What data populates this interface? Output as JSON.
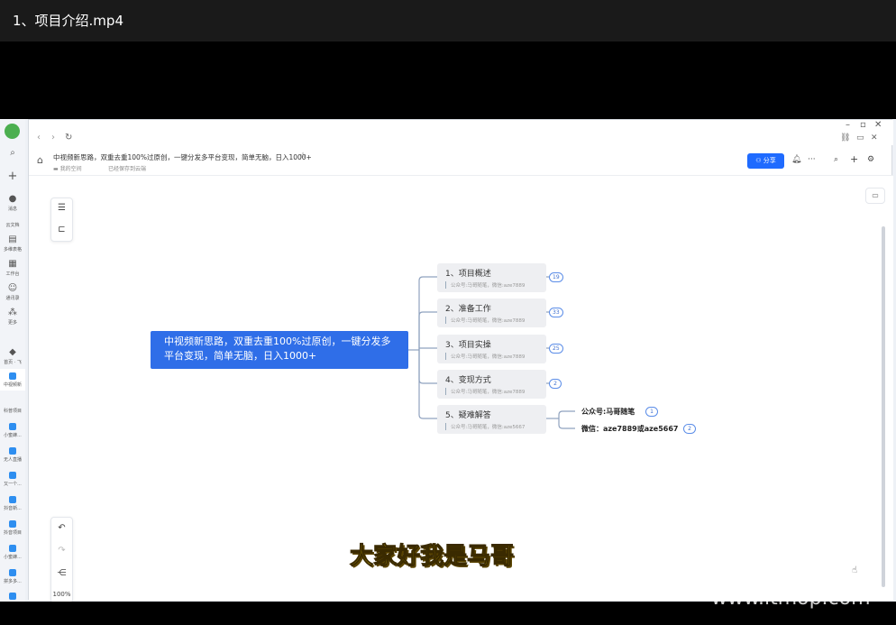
{
  "player": {
    "title": "1、项目介绍.mp4"
  },
  "doc": {
    "title": "中视频新思路，双重去重100%过原创，一键分发多平台变现，简单无脑，日入1000+",
    "space": "我的空间",
    "saved": "已经保存到云端",
    "share_label": "分享",
    "zoom": "100%"
  },
  "rail": {
    "items": [
      {
        "label": "消息"
      },
      {
        "label": "云文档"
      },
      {
        "label": "多维表格"
      },
      {
        "label": "工作台"
      },
      {
        "label": "通讯录"
      },
      {
        "label": "更多"
      },
      {
        "label": "首页 · 飞"
      },
      {
        "label": "中视频新"
      },
      {
        "label": "科普项目"
      },
      {
        "label": "小蜜蜂..."
      },
      {
        "label": "无人直播"
      },
      {
        "label": "又一个..."
      },
      {
        "label": "抖音新..."
      },
      {
        "label": "抖音项目"
      },
      {
        "label": "小蜜蜂..."
      },
      {
        "label": "拼多多..."
      }
    ]
  },
  "mindmap": {
    "root": "中视频新思路，双重去重100%过原创，一键分发多平台变现，简单无脑，日入1000+",
    "nodes": [
      {
        "title": "1、项目概述",
        "note": "公众号:马哥随笔，微信:aze7889",
        "count": "19"
      },
      {
        "title": "2、准备工作",
        "note": "公众号:马哥随笔，微信:aze7889",
        "count": "33"
      },
      {
        "title": "3、项目实操",
        "note": "公众号:马哥随笔，微信:aze7889",
        "count": "25"
      },
      {
        "title": "4、变现方式",
        "note": "公众号:马哥随笔，微信:aze7889",
        "count": "2"
      },
      {
        "title": "5、疑难解答",
        "note": "公众号:马哥随笔，微信:aze5667",
        "count": ""
      }
    ],
    "leaves": [
      {
        "text": "公众号:马哥随笔",
        "count": "1"
      },
      {
        "text": "微信：aze7889或aze5667",
        "count": "2"
      }
    ]
  },
  "overlay": {
    "subtitle": "大家好我是马哥",
    "watermark": "www.itmop.com"
  }
}
